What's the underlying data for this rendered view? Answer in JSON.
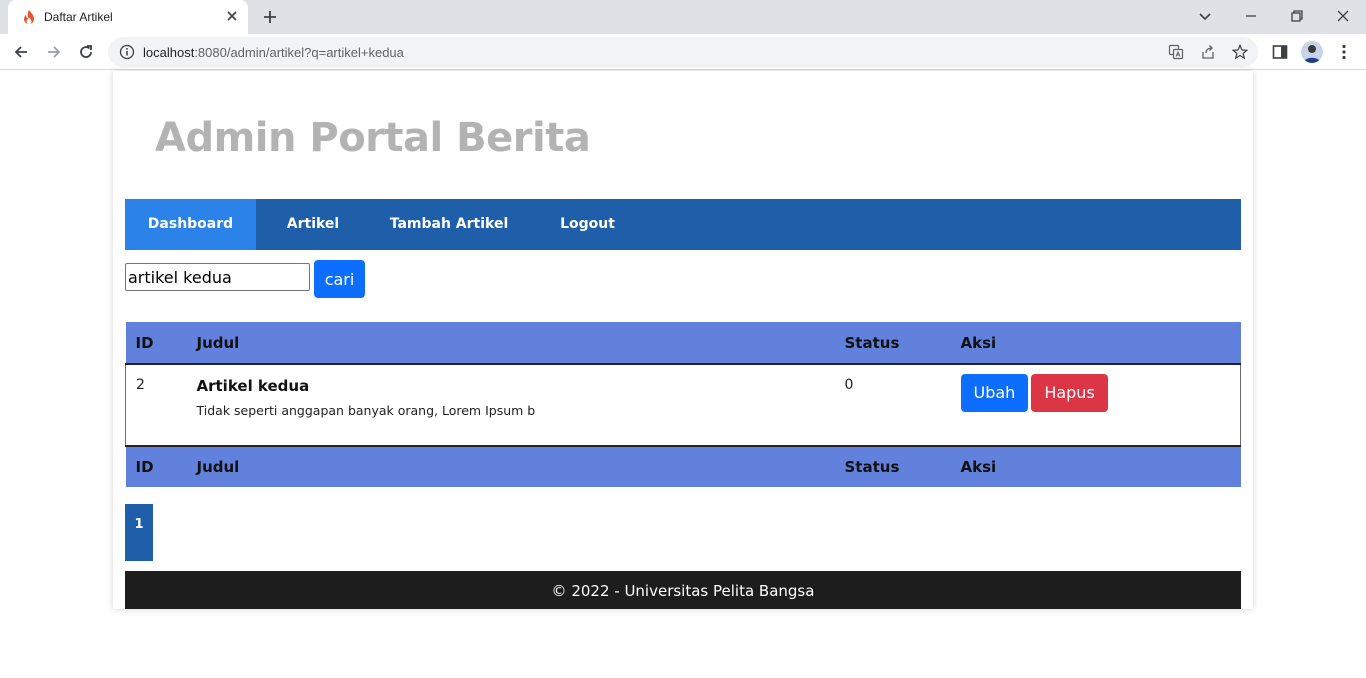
{
  "browser": {
    "tab_title": "Daftar Artikel",
    "url_host": "localhost",
    "url_rest": ":8080/admin/artikel?q=artikel+kedua"
  },
  "site": {
    "title": "Admin Portal Berita"
  },
  "nav": {
    "items": [
      {
        "label": "Dashboard",
        "active": true
      },
      {
        "label": "Artikel"
      },
      {
        "label": "Tambah Artikel"
      },
      {
        "label": "Logout"
      }
    ]
  },
  "search": {
    "value": "artikel kedua",
    "button_label": "cari"
  },
  "table": {
    "headers": [
      "ID",
      "Judul",
      "Status",
      "Aksi"
    ],
    "rows": [
      {
        "id": "2",
        "title": "Artikel kedua",
        "excerpt": "Tidak seperti anggapan banyak orang, Lorem Ipsum b",
        "status": "0",
        "edit_label": "Ubah",
        "delete_label": "Hapus"
      }
    ]
  },
  "pagination": {
    "current": "1"
  },
  "footer": {
    "text": "© 2022 - Universitas Pelita Bangsa"
  },
  "colors": {
    "nav_bg": "#1f5faa",
    "nav_active": "#2b83ea",
    "table_head": "#6281dd",
    "primary": "#0d6efd",
    "danger": "#dc3545",
    "footer_bg": "#1d1d1d"
  }
}
